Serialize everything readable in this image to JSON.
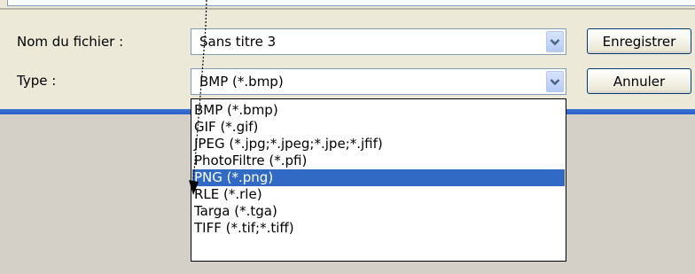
{
  "labels": {
    "filename": "Nom du fichier :",
    "type": "Type :"
  },
  "filename_field": {
    "value": "Sans titre 3"
  },
  "type_field": {
    "value": "BMP (*.bmp)"
  },
  "buttons": {
    "save": "Enregistrer",
    "cancel": "Annuler"
  },
  "type_options": [
    {
      "label": "BMP (*.bmp)",
      "selected": false
    },
    {
      "label": "GIF (*.gif)",
      "selected": false
    },
    {
      "label": "JPEG (*.jpg;*.jpeg;*.jpe;*.jfif)",
      "selected": false
    },
    {
      "label": "PhotoFiltre (*.pfi)",
      "selected": false
    },
    {
      "label": "PNG (*.png)",
      "selected": true
    },
    {
      "label": "RLE (*.rle)",
      "selected": false
    },
    {
      "label": "Targa (*.tga)",
      "selected": false
    },
    {
      "label": "TIFF (*.tif;*.tiff)",
      "selected": false
    }
  ],
  "colors": {
    "selection": "#316ac5",
    "dialog_bg": "#ece9d8",
    "accent_line": "#2a5fc4",
    "field_border": "#7f9db9"
  },
  "icons": {
    "combo_arrow": "chevron-down-icon",
    "annotation": "arrow-pointer-icon"
  }
}
